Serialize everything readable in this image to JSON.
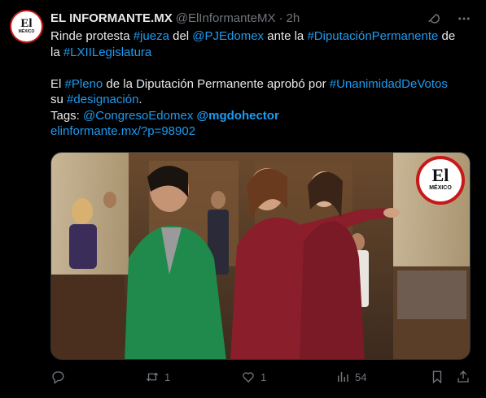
{
  "author": {
    "name": "EL INFORMANTE.MX",
    "handle": "@ElInformanteMX",
    "separator": "·",
    "time": "2h",
    "avatar_text": "El",
    "avatar_subtext": "MÉXICO"
  },
  "tweet": {
    "line1": {
      "a": "Rinde protesta ",
      "b": "#jueza",
      "c": " del ",
      "d": "@PJEdomex",
      "e": " ante la ",
      "f": "#DiputaciónPermanente",
      "g": " de"
    },
    "line2": {
      "a": "la ",
      "b": "#LXIILegislatura"
    },
    "line3": {
      "a": "El ",
      "b": "#Pleno",
      "c": " de la Diputación Permanente aprobó por ",
      "d": "#UnanimidadDeVotos"
    },
    "line4": {
      "a": "su ",
      "b": "#designación",
      "c": "."
    },
    "line5": {
      "a": "Tags: ",
      "b": "@CongresoEdomex",
      "c": " ",
      "d": "@mgdohector"
    },
    "line6": {
      "a": "elinformante.mx/?p=98902"
    }
  },
  "media": {
    "watermark_text": "El",
    "watermark_subtext": "MÉXICO"
  },
  "actions": {
    "reply_count": "",
    "retweet_count": "1",
    "like_count": "1",
    "views_count": "54"
  },
  "icons": [
    "grok-icon",
    "more-icon",
    "reply-icon",
    "retweet-icon",
    "like-icon",
    "views-icon",
    "bookmark-icon",
    "share-icon"
  ],
  "colors": {
    "link": "#1d9bf0",
    "muted": "#71767b",
    "text": "#e7e9ea",
    "background": "#000000"
  }
}
